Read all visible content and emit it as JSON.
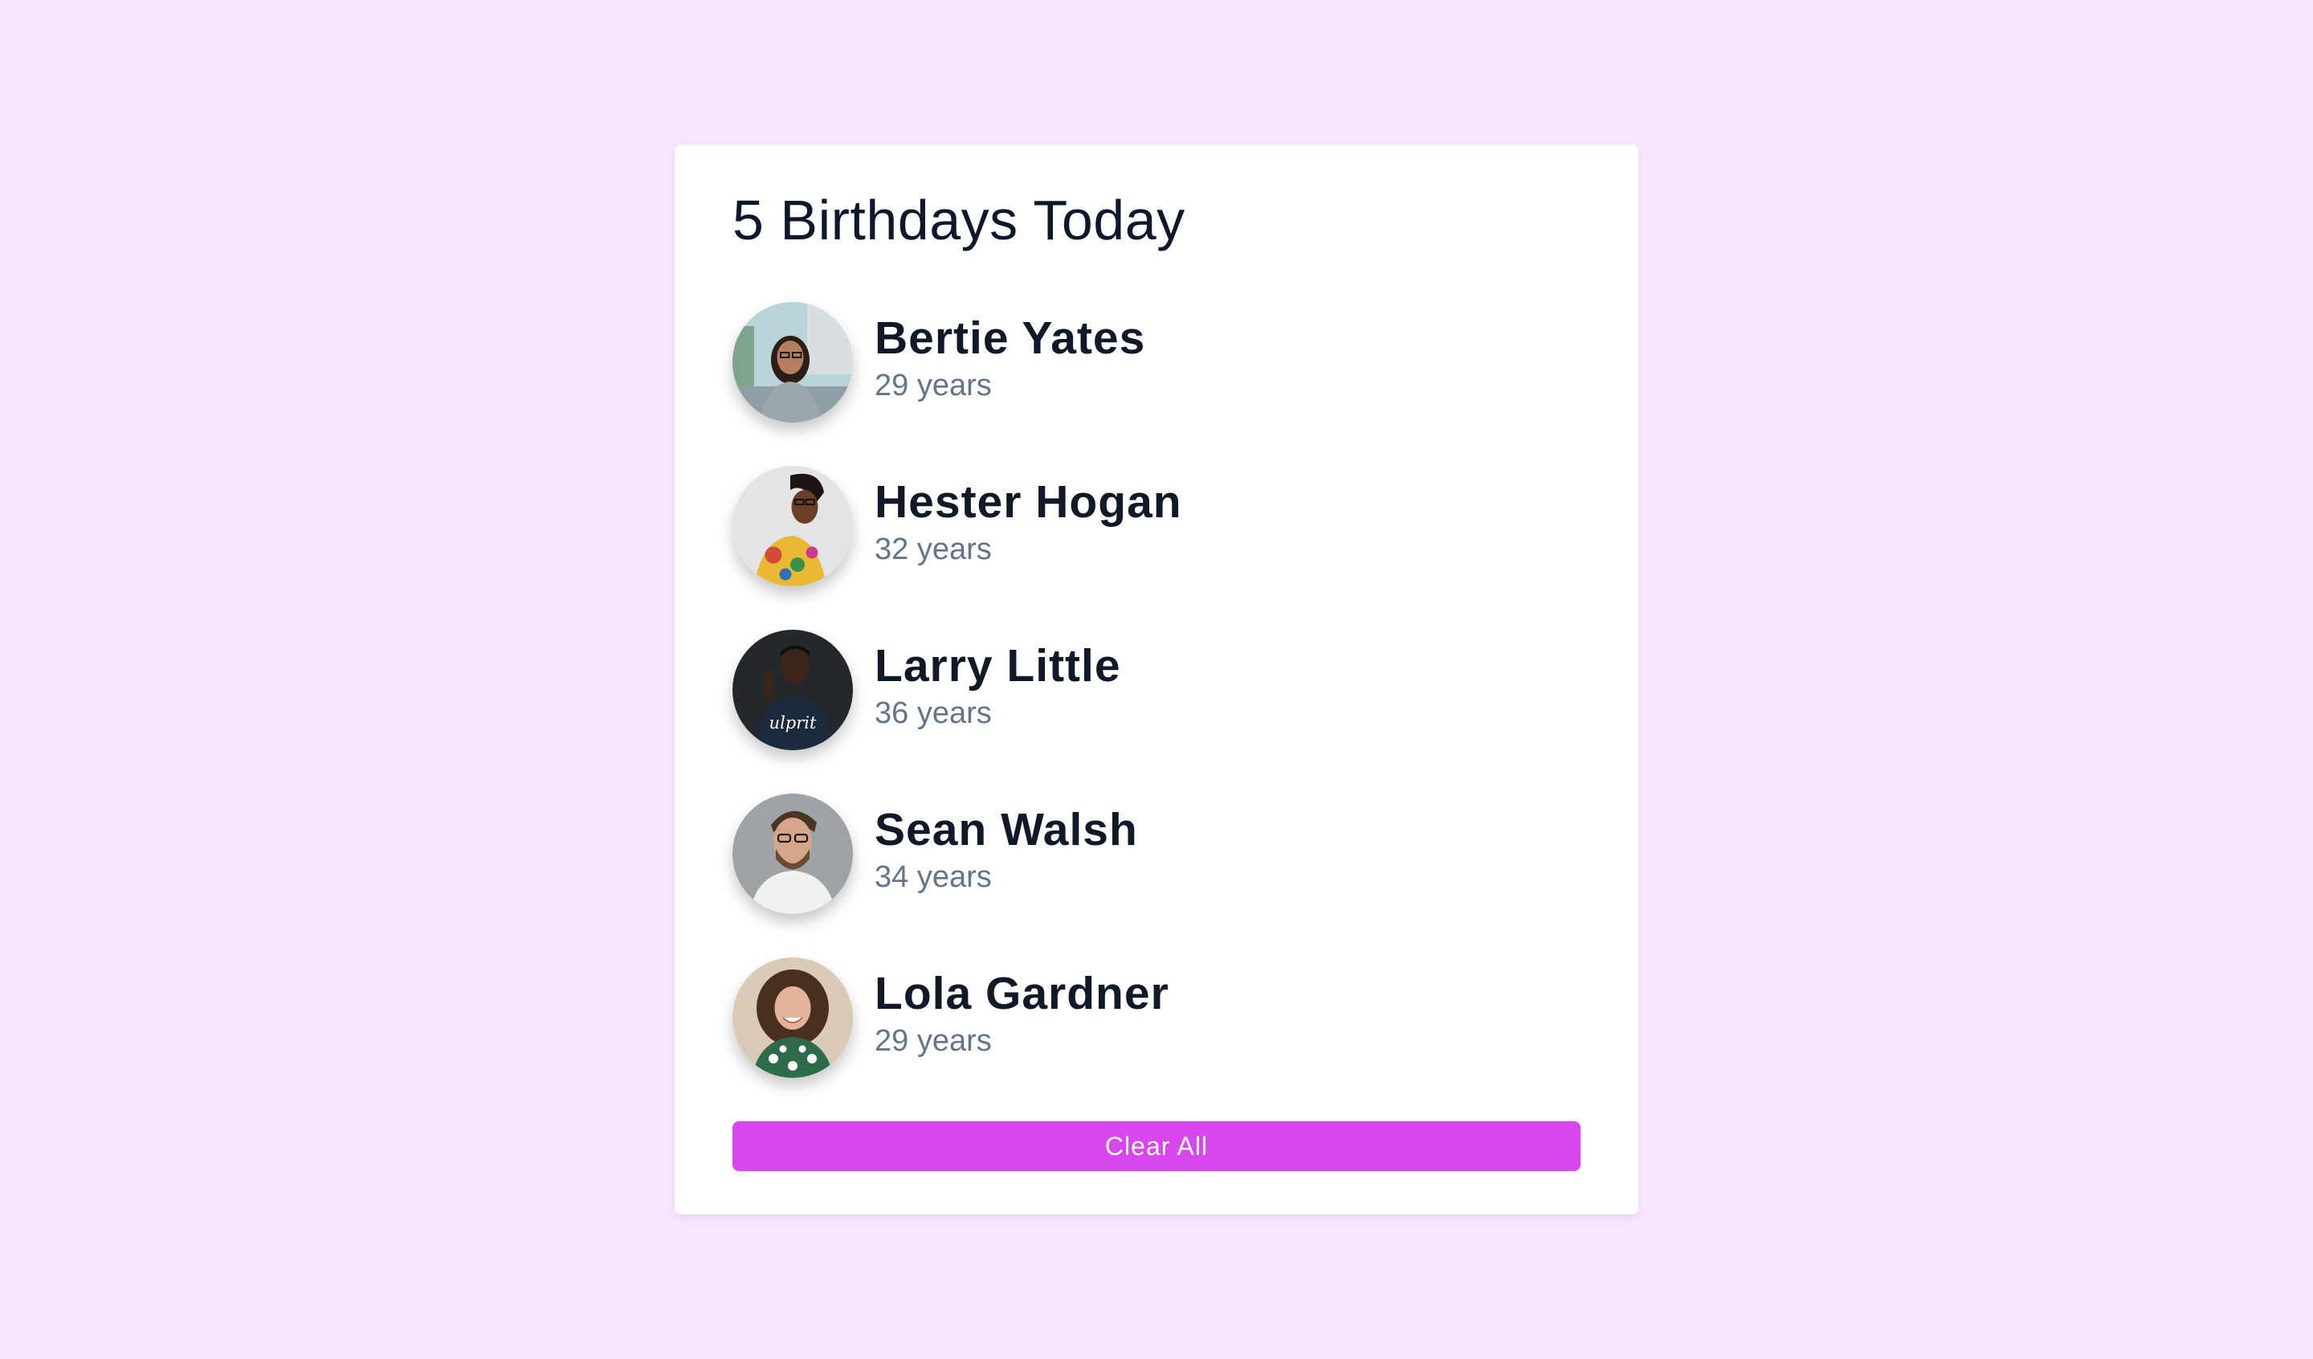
{
  "header": {
    "title": "5 Birthdays Today"
  },
  "people": [
    {
      "name": "Bertie Yates",
      "age": "29 years",
      "avatar_icon": "photo-woman-street"
    },
    {
      "name": "Hester Hogan",
      "age": "32 years",
      "avatar_icon": "photo-woman-glasses"
    },
    {
      "name": "Larry Little",
      "age": "36 years",
      "avatar_icon": "photo-man-dark-shirt"
    },
    {
      "name": "Sean Walsh",
      "age": "34 years",
      "avatar_icon": "photo-man-beard-glasses"
    },
    {
      "name": "Lola Gardner",
      "age": "29 years",
      "avatar_icon": "photo-woman-curly-hair"
    }
  ],
  "actions": {
    "clear_label": "Clear All"
  },
  "colors": {
    "background": "#f9e6fe",
    "accent": "#d946ef",
    "name_text": "#111827",
    "age_text": "#64748b"
  }
}
